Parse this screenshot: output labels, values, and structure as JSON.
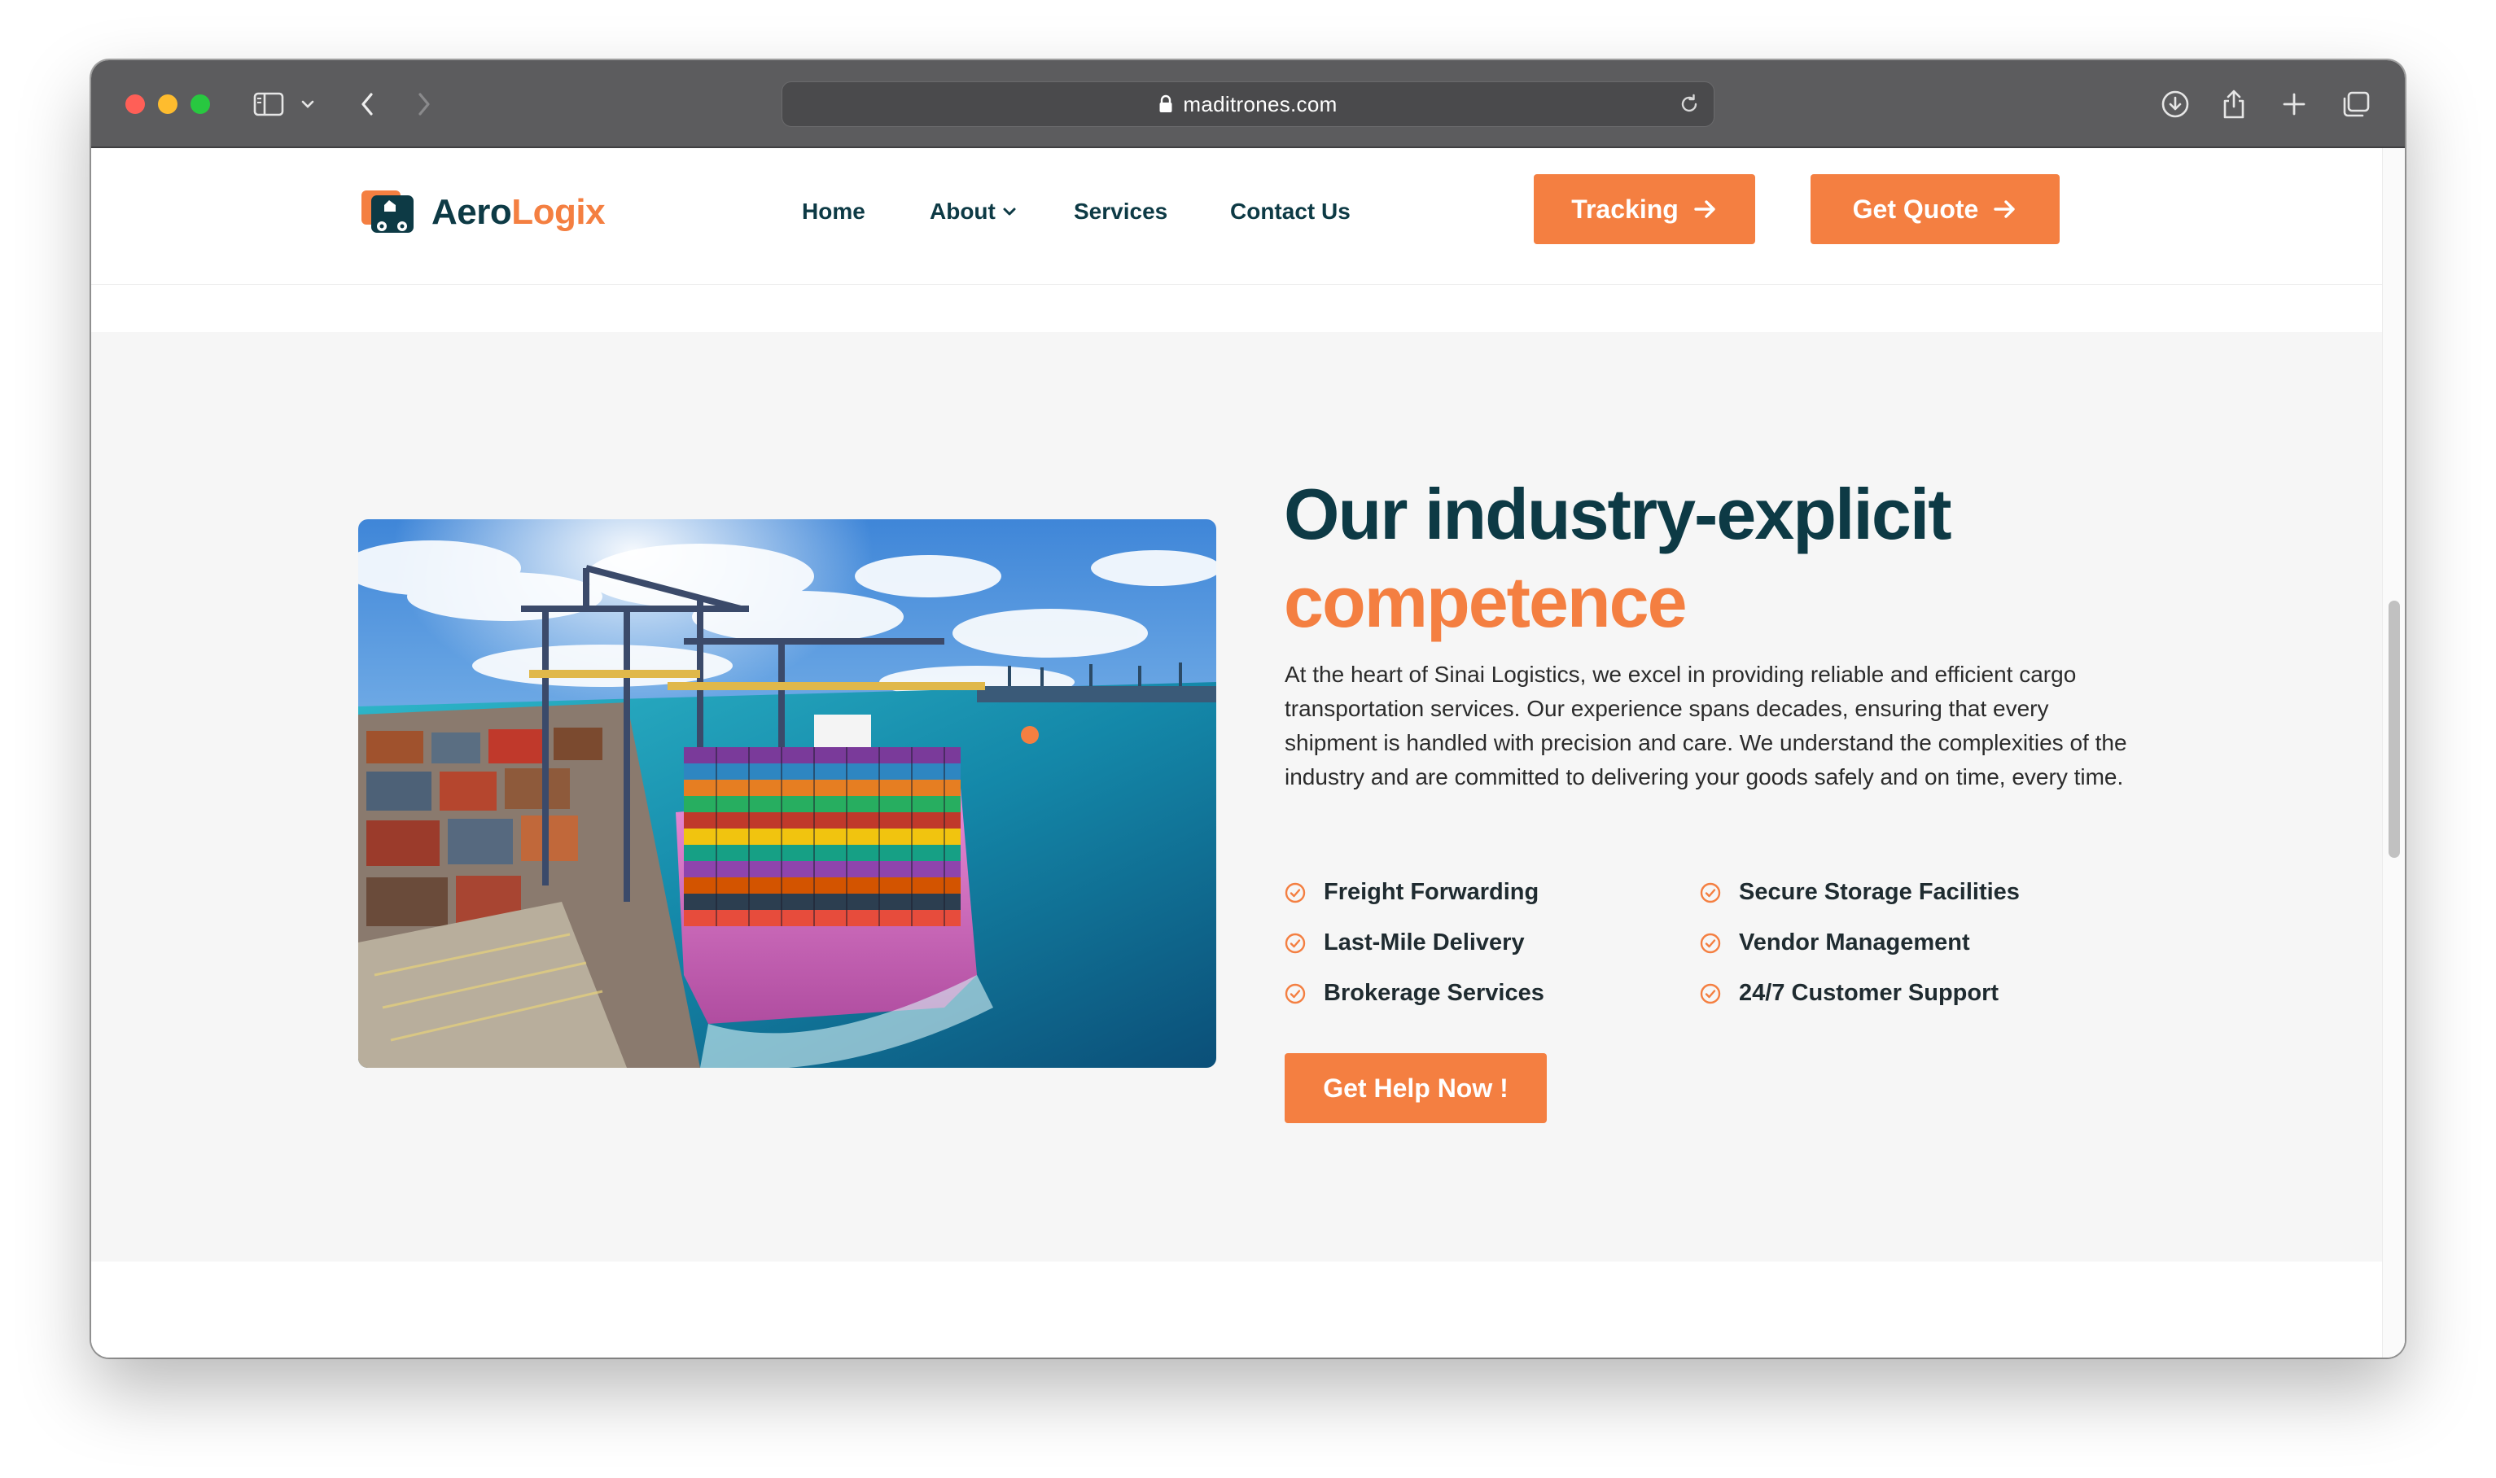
{
  "browser": {
    "url": "maditrones.com"
  },
  "nav": {
    "logo_part1": "Aero",
    "logo_part2": "Logix",
    "items": [
      {
        "label": "Home"
      },
      {
        "label": "About"
      },
      {
        "label": "Services"
      },
      {
        "label": "Contact Us"
      }
    ],
    "tracking_label": "Tracking",
    "quote_label": "Get Quote"
  },
  "section": {
    "heading_line1": "Our industry-explicit",
    "heading_line2": "competence",
    "paragraph": "At the heart of Sinai Logistics, we excel in providing reliable and efficient cargo transportation services. Our experience spans decades, ensuring that every shipment is handled with precision and care. We understand the complexities of the industry and are committed to delivering your goods safely and on time, every time.",
    "features": [
      {
        "label": "Freight Forwarding"
      },
      {
        "label": "Secure Storage Facilities"
      },
      {
        "label": "Last-Mile Delivery"
      },
      {
        "label": "Vendor Management"
      },
      {
        "label": "Brokerage Services"
      },
      {
        "label": "24/7 Customer Support"
      }
    ],
    "cta_label": "Get Help Now !",
    "image_alt": "container ship at port"
  },
  "colors": {
    "accent": "#f47f41",
    "brand_dark": "#0d3a45",
    "section_bg": "#f6f6f6"
  }
}
